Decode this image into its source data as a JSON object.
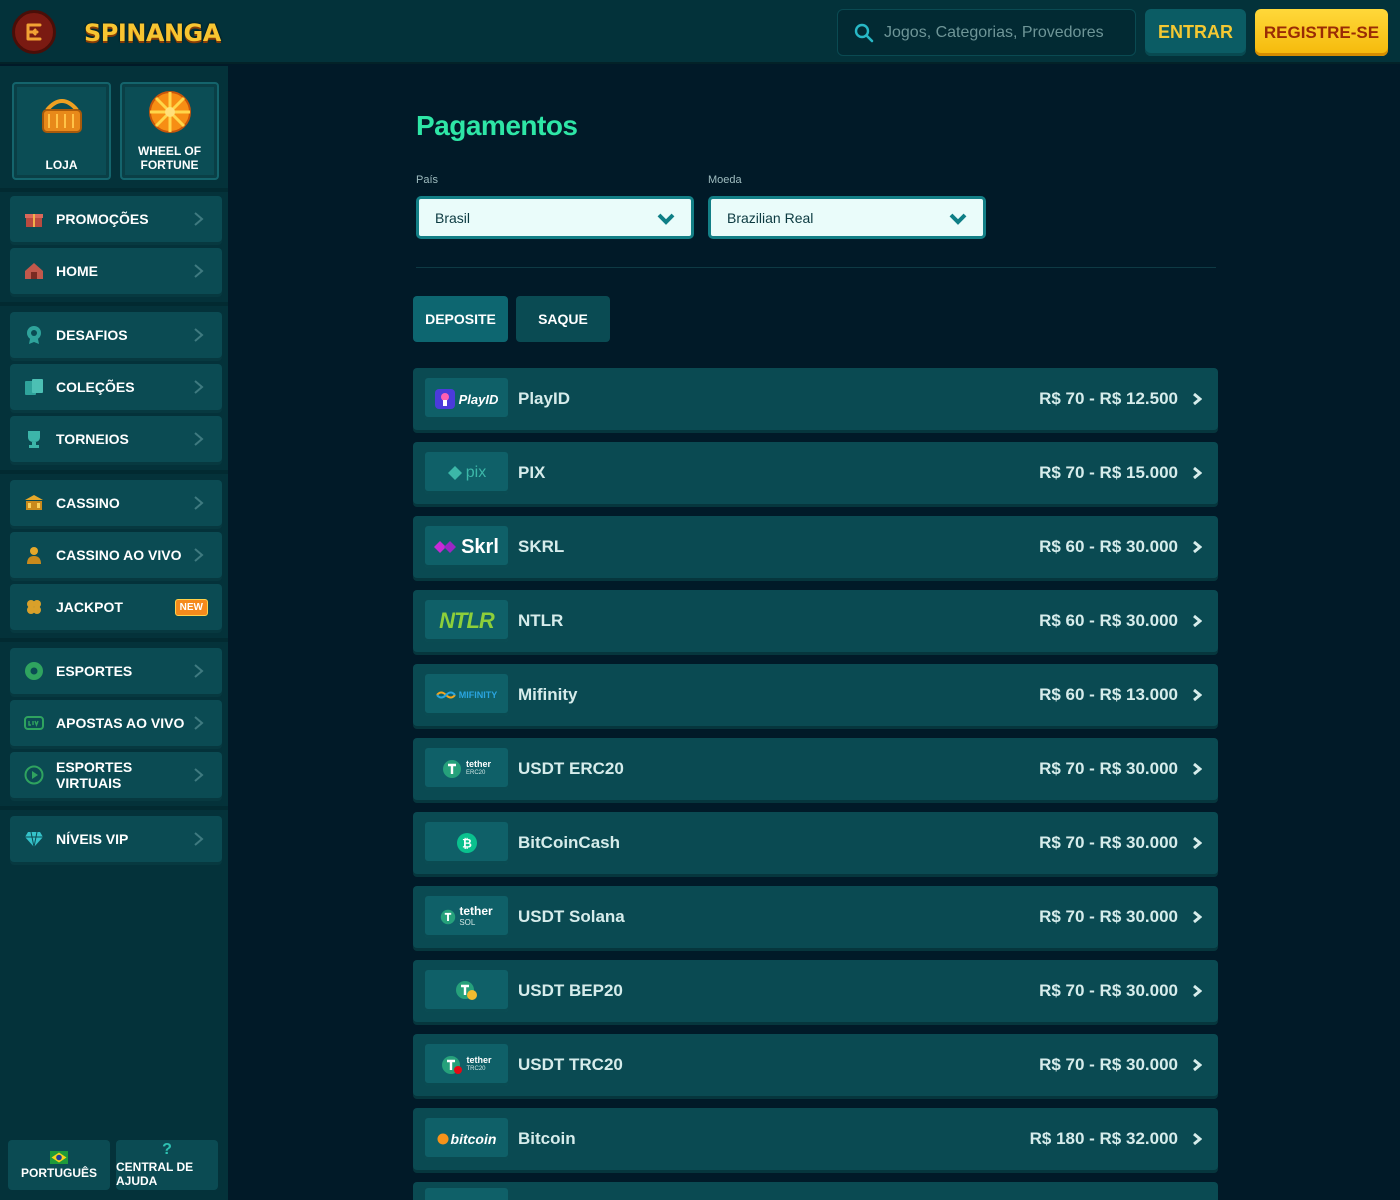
{
  "header": {
    "logo_text": "SPINANGA",
    "search_placeholder": "Jogos, Categorias, Provedores",
    "login_label": "ENTRAR",
    "register_label": "REGISTRE-SE"
  },
  "sidebar": {
    "featured": [
      {
        "label": "LOJA"
      },
      {
        "label": "WHEEL OF FORTUNE"
      }
    ],
    "items": [
      {
        "label": "PROMOÇÕES",
        "icon": "gift-icon"
      },
      {
        "label": "HOME",
        "icon": "home-icon"
      },
      {
        "label": "DESAFIOS",
        "icon": "badge-icon"
      },
      {
        "label": "COLEÇÕES",
        "icon": "cards-icon"
      },
      {
        "label": "TORNEIOS",
        "icon": "trophy-icon"
      },
      {
        "label": "CASSINO",
        "icon": "casino-icon"
      },
      {
        "label": "CASSINO AO VIVO",
        "icon": "dealer-icon"
      },
      {
        "label": "JACKPOT",
        "icon": "clover-icon",
        "badge": "NEW"
      },
      {
        "label": "ESPORTES",
        "icon": "ball-icon"
      },
      {
        "label": "APOSTAS AO VIVO",
        "icon": "live-icon"
      },
      {
        "label": "ESPORTES VIRTUAIS",
        "icon": "play-icon"
      },
      {
        "label": "NÍVEIS VIP",
        "icon": "diamond-icon"
      }
    ],
    "footer": {
      "language_label": "PORTUGUÊS",
      "help_label": "CENTRAL DE AJUDA"
    }
  },
  "main": {
    "title": "Pagamentos",
    "country_label": "País",
    "country_value": "Brasil",
    "currency_label": "Moeda",
    "currency_value": "Brazilian Real",
    "tabs": [
      {
        "label": "DEPOSITE",
        "active": true
      },
      {
        "label": "SAQUE",
        "active": false
      }
    ],
    "methods": [
      {
        "name": "PlayID",
        "range": "R$ 70 - R$ 12.500",
        "logo": "PlayID"
      },
      {
        "name": "PIX",
        "range": "R$ 70 - R$ 15.000",
        "logo": "pix"
      },
      {
        "name": "SKRL",
        "range": "R$ 60 - R$ 30.000",
        "logo": "Skrl"
      },
      {
        "name": "NTLR",
        "range": "R$ 60 - R$ 30.000",
        "logo": "NTLR"
      },
      {
        "name": "Mifinity",
        "range": "R$ 60 - R$ 13.000",
        "logo": "MIFINITY"
      },
      {
        "name": "USDT ERC20",
        "range": "R$ 70 - R$ 30.000",
        "logo": "tether",
        "logo_sub": "ERC20"
      },
      {
        "name": "BitCoinCash",
        "range": "R$ 70 - R$ 30.000",
        "logo": ""
      },
      {
        "name": "USDT Solana",
        "range": "R$ 70 - R$ 30.000",
        "logo": "tether",
        "logo_sub": "SOL"
      },
      {
        "name": "USDT BEP20",
        "range": "R$ 70 - R$ 30.000",
        "logo": ""
      },
      {
        "name": "USDT TRC20",
        "range": "R$ 70 - R$ 30.000",
        "logo": "tether",
        "logo_sub": "TRC20"
      },
      {
        "name": "Bitcoin",
        "range": "R$ 180 - R$ 32.000",
        "logo": "bitcoin"
      }
    ]
  },
  "colors": {
    "accent_green": "#2ee6a6",
    "accent_yellow": "#f4c832",
    "panel": "#0a4a52",
    "background": "#011a28"
  }
}
